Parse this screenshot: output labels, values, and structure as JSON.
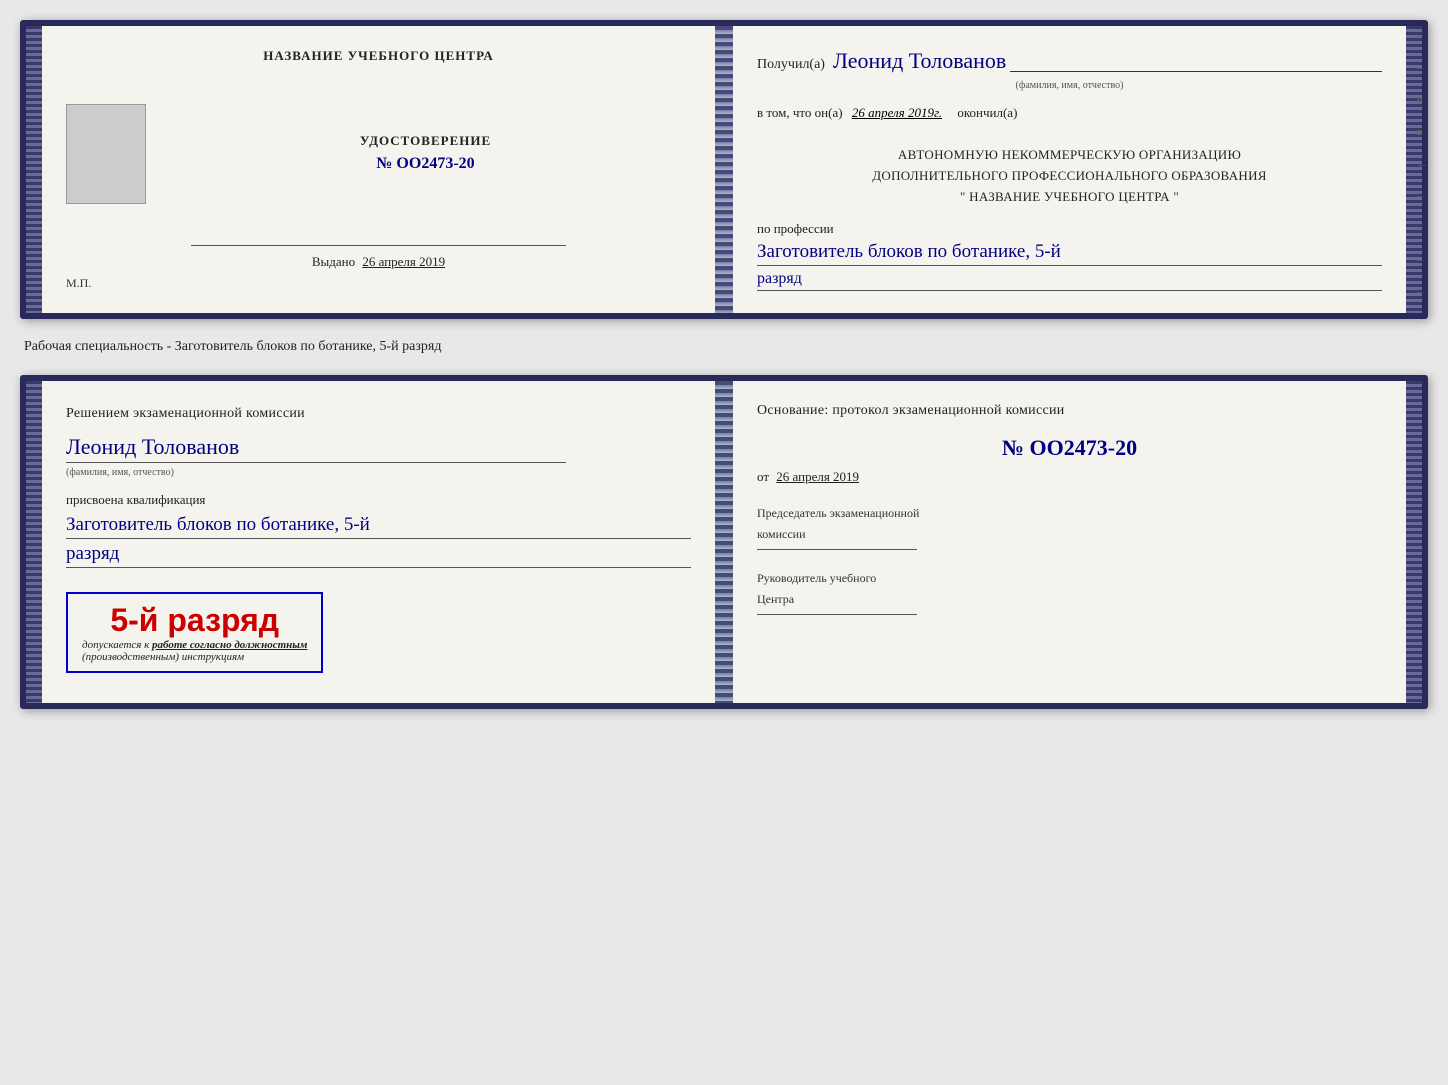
{
  "doc1": {
    "left": {
      "center_title": "НАЗВАНИЕ УЧЕБНОГО ЦЕНТРА",
      "udostoverenie": "УДОСТОВЕРЕНИЕ",
      "number": "№ OO2473-20",
      "vydano_label": "Выдано",
      "vydano_date": "26 апреля 2019",
      "mp_label": "М.П."
    },
    "right": {
      "poluchil_prefix": "Получил(а)",
      "poluchil_name": "Леонид Толованов",
      "fio_label": "(фамилия, имя, отчество)",
      "vtom_prefix": "в том, что он(а)",
      "vtom_date": "26 апреля 2019г.",
      "okoncil": "окончил(а)",
      "org_line1": "АВТОНОМНУЮ НЕКОММЕРЧЕСКУЮ ОРГАНИЗАЦИЮ",
      "org_line2": "ДОПОЛНИТЕЛЬНОГО ПРОФЕССИОНАЛЬНОГО ОБРАЗОВАНИЯ",
      "org_line3": "\"  НАЗВАНИЕ УЧЕБНОГО ЦЕНТРА  \"",
      "po_professii": "по профессии",
      "profession_handwritten": "Заготовитель блоков по ботанике, 5-й",
      "razryad_handwritten": "разряд"
    }
  },
  "specialty_label": "Рабочая специальность - Заготовитель блоков по ботанике, 5-й разряд",
  "doc2": {
    "left": {
      "decision_text": "Решением экзаменационной комиссии",
      "name_handwritten": "Леонид Толованов",
      "fio_label": "(фамилия, имя, отчество)",
      "prisvoena": "присвоена квалификация",
      "qualification_handwritten": "Заготовитель блоков по ботанике, 5-й",
      "razryad_handwritten": "разряд",
      "stamp_main": "5-й разряд",
      "dopuskaetsya": "допускается к",
      "rabota_text": "работе согласно должностным",
      "instruktsii_text": "(производственным) инструкциям"
    },
    "right": {
      "osnovanie": "Основание: протокол экзаменационной комиссии",
      "number": "№  OO2473-20",
      "ot_label": "от",
      "ot_date": "26 апреля 2019",
      "predsedatel_line1": "Председатель экзаменационной",
      "predsedatel_line2": "комиссии",
      "rukovoditel_line1": "Руководитель учебного",
      "rukovoditel_line2": "Центра"
    }
  },
  "side_marks": {
    "items": [
      "–",
      "–",
      "и",
      "а",
      "←",
      "–",
      "–",
      "–",
      "–"
    ]
  }
}
